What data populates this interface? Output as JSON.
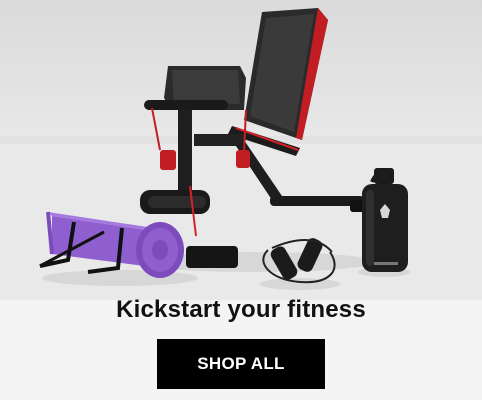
{
  "banner": {
    "headline": "Kickstart your fitness",
    "cta_label": "SHOP ALL"
  },
  "products": [
    "weight-bench",
    "yoga-mat",
    "jump-rope",
    "water-bottle"
  ],
  "colors": {
    "button_bg": "#000000",
    "button_text": "#ffffff",
    "headline_text": "#111111",
    "mat": "#8f5fd0",
    "bench_accent": "#e0262b"
  }
}
